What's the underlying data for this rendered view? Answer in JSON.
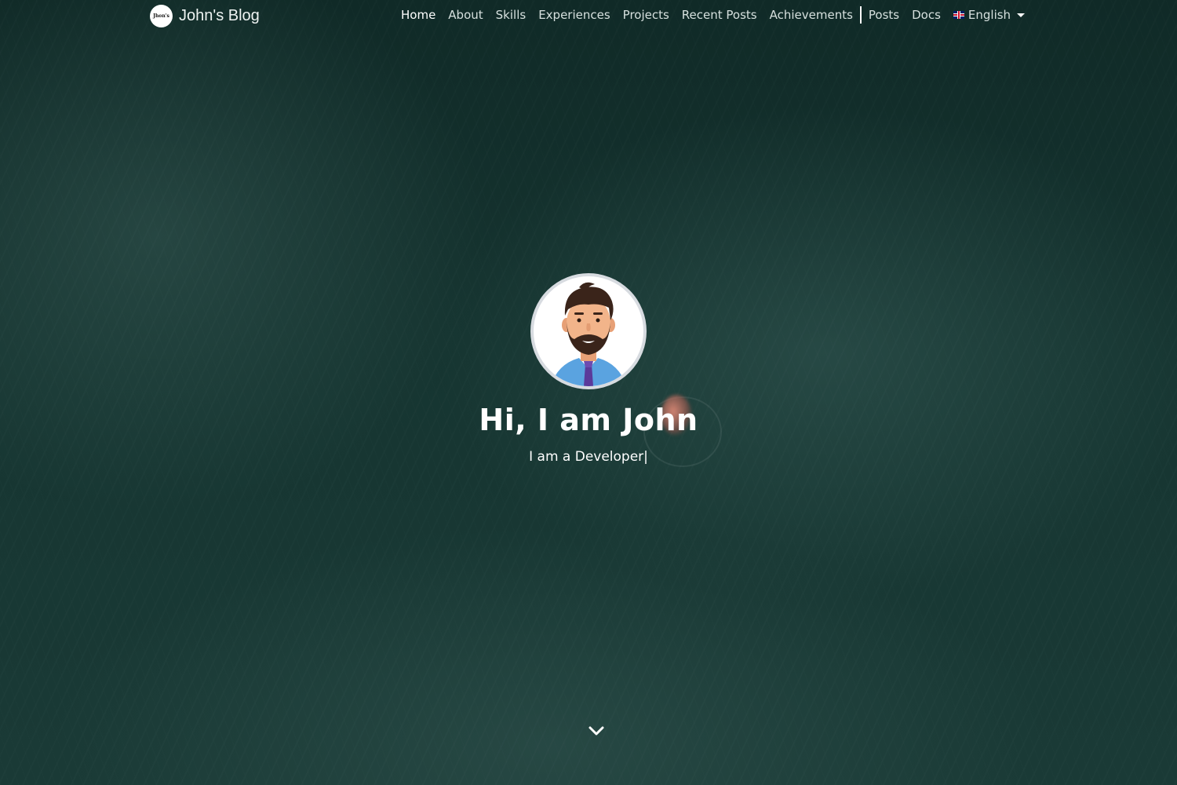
{
  "brand": {
    "logo_text": "Jhon's",
    "title": "John's Blog"
  },
  "nav": {
    "items": [
      {
        "label": "Home",
        "active": true
      },
      {
        "label": "About"
      },
      {
        "label": "Skills"
      },
      {
        "label": "Experiences"
      },
      {
        "label": "Projects"
      },
      {
        "label": "Recent Posts"
      },
      {
        "label": "Achievements"
      }
    ],
    "extra_items": [
      {
        "label": "Posts"
      },
      {
        "label": "Docs"
      }
    ],
    "language": {
      "label": "English",
      "flag_icon": "uk-flag-icon"
    }
  },
  "hero": {
    "title": "Hi, I am John",
    "subtitle": "I am a Developer|",
    "avatar_icon": "bearded-man-avatar"
  },
  "scroll": {
    "icon": "chevron-down-icon"
  },
  "colors": {
    "background": "#13302c",
    "text": "#ffffff"
  }
}
